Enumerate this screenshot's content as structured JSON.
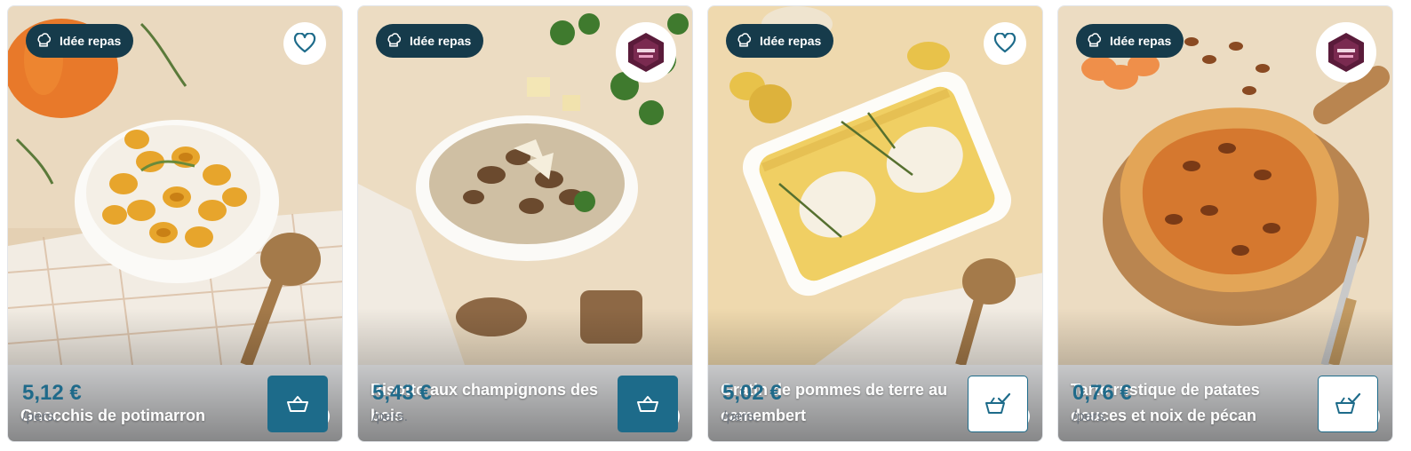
{
  "badge_label": "Idée repas",
  "per_label": "/pers.",
  "colors": {
    "accent": "#1d6b8a",
    "badge_bg": "#163b4b",
    "price": "#1f6a8a"
  },
  "cards": [
    {
      "title": "Gnocchis de potimarron",
      "persons": "4",
      "price": "5,12 €",
      "corner": "heart-icon",
      "cart_state": "add"
    },
    {
      "title": "Risotto aux champignons des bois",
      "persons": "4",
      "price": "5,43 €",
      "corner": "chef-logo",
      "cart_state": "add"
    },
    {
      "title": "Gratin de pommes de terre au camembert",
      "persons": "4",
      "price": "5,02 €",
      "corner": "heart-icon",
      "cart_state": "added"
    },
    {
      "title": "Tarte rustique de patates douces et noix de pécan",
      "persons": "4",
      "price": "0,76 €",
      "corner": "chef-logo",
      "cart_state": "added"
    }
  ]
}
